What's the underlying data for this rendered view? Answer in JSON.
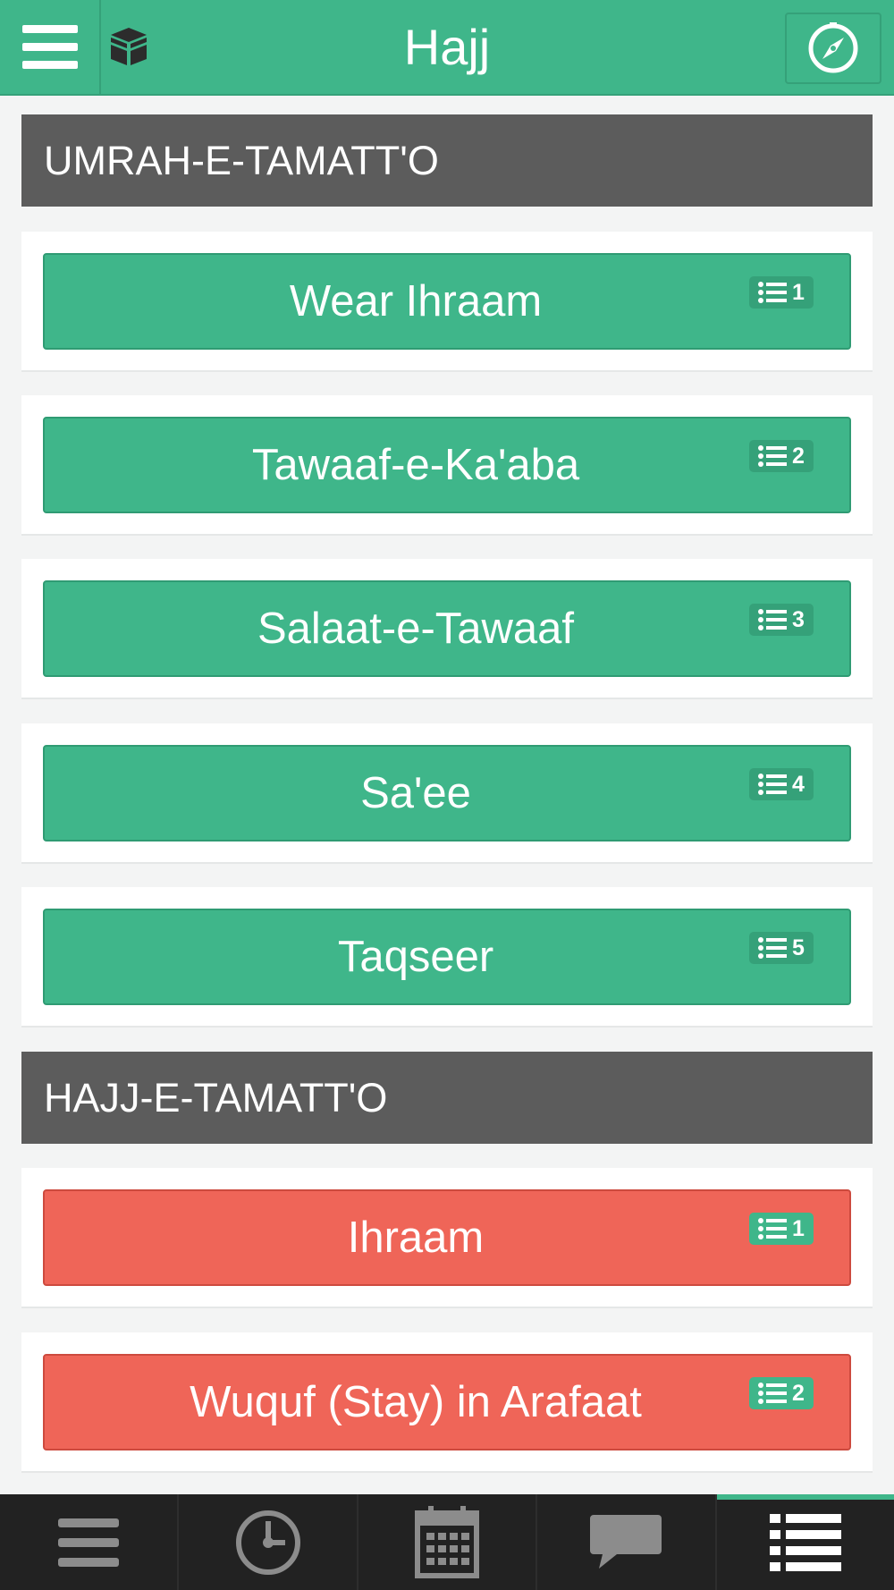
{
  "header": {
    "title": "Hajj",
    "menu_icon": "hamburger-menu-icon",
    "logo_icon": "kaaba-icon",
    "compass_icon": "compass-icon"
  },
  "sections": [
    {
      "title": "UMRAH-E-TAMATT'O",
      "color": "#3fb68a",
      "steps": [
        {
          "label": "Wear Ihraam",
          "badge": "1"
        },
        {
          "label": "Tawaaf-e-Ka'aba",
          "badge": "2"
        },
        {
          "label": "Salaat-e-Tawaaf",
          "badge": "3"
        },
        {
          "label": "Sa'ee",
          "badge": "4"
        },
        {
          "label": "Taqseer",
          "badge": "5"
        }
      ]
    },
    {
      "title": "HAJJ-E-TAMATT'O",
      "color": "#ef6558",
      "steps": [
        {
          "label": "Ihraam",
          "badge": "1"
        },
        {
          "label": "Wuquf (Stay) in Arafaat",
          "badge": "2"
        }
      ]
    }
  ],
  "tabbar": {
    "tabs": [
      {
        "icon": "menu-lines-icon",
        "active": false
      },
      {
        "icon": "clock-icon",
        "active": false
      },
      {
        "icon": "calendar-icon",
        "active": false
      },
      {
        "icon": "chat-bubble-icon",
        "active": false
      },
      {
        "icon": "list-icon",
        "active": true
      }
    ]
  },
  "colors": {
    "brand_green": "#3fb68a",
    "alert_red": "#ef6558",
    "section_gray": "#5c5c5c",
    "tabbar_dark": "#222222"
  }
}
